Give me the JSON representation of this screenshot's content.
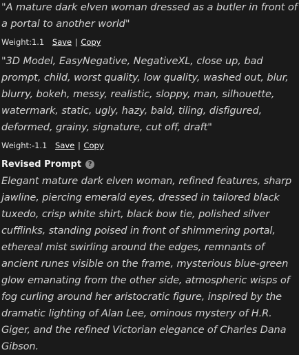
{
  "prompts": [
    {
      "text": "\"A mature dark elven woman dressed as a butler in front of a portal to another world\"",
      "weight_label": "Weight:1.1",
      "save_label": "Save",
      "separator": "|",
      "copy_label": "Copy"
    },
    {
      "text": "\"3D Model, EasyNegative, NegativeXL, close up, bad prompt, child, worst quality, low quality, washed out, blur, blurry, bokeh, messy, realistic, sloppy, man, silhouette, watermark, static, ugly, hazy, bald, tiling, disfigured, deformed, grainy, signature, cut off, draft\"",
      "weight_label": "Weight:-1.1",
      "save_label": "Save",
      "separator": "|",
      "copy_label": "Copy"
    }
  ],
  "revised": {
    "heading": "Revised Prompt",
    "help_icon": "question-circle-icon",
    "help_glyph": "?",
    "text": "Elegant mature dark elven woman, refined features, sharp jawline, piercing emerald eyes, dressed in tailored black tuxedo, crisp white shirt, black bow tie, polished silver cufflinks, standing poised in front of shimmering portal, ethereal mist swirling around the edges, remnants of ancient runes visible on the frame, mysterious blue-green glow emanating from the other side, atmospheric wisps of fog curling around her aristocratic figure, inspired by the dramatic lighting of Alan Lee, ominous mystery of H.R. Giger, and the refined Victorian elegance of Charles Dana Gibson."
  },
  "colors": {
    "background": "#1a1a1a",
    "text": "#d2d2d2",
    "link": "#ffffff",
    "help_icon_bg": "#8a8a8a"
  }
}
